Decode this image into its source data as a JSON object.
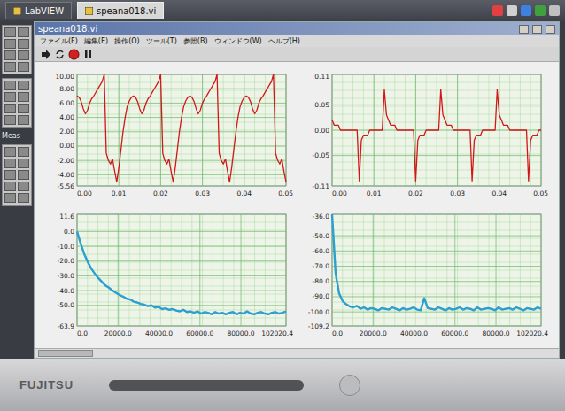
{
  "taskbar": {
    "tabs": [
      {
        "label": "LabVIEW",
        "selected": false
      },
      {
        "label": "speana018.vi",
        "selected": true
      }
    ]
  },
  "palette": {
    "label": "Meas"
  },
  "window": {
    "title": "speana018.vi",
    "menu": [
      "ファイル(F)",
      "編集(E)",
      "操作(O)",
      "ツール(T)",
      "参照(B)",
      "ウィンドウ(W)",
      "ヘルプ(H)"
    ]
  },
  "charts": [
    {
      "y_ticks": [
        "10.00",
        "8.00",
        "6.00",
        "4.00",
        "2.00",
        "0.00",
        "-2.00",
        "-4.00",
        "-5.56"
      ],
      "x_ticks": [
        "0.00",
        "0.01",
        "0.02",
        "0.03",
        "0.04",
        "0.05"
      ],
      "series": [
        {
          "color": "#d01818",
          "values": [
            7.0,
            6.8,
            6.2,
            5.2,
            4.5,
            5.0,
            6.0,
            6.6,
            7.0,
            7.5,
            8.0,
            8.5,
            9.0,
            10.0,
            -1.0,
            -2.0,
            -2.5,
            -1.8,
            -3.5,
            -5.0,
            -3.0,
            -0.5,
            2.0,
            4.0,
            5.5,
            6.3,
            6.8,
            7.0,
            6.8,
            6.2,
            5.2,
            4.5,
            5.0,
            6.0,
            6.6,
            7.0,
            7.5,
            8.0,
            8.5,
            9.0,
            10.0,
            -1.0,
            -2.0,
            -2.5,
            -1.8,
            -3.5,
            -5.0,
            -3.0,
            -0.5,
            2.0,
            4.0,
            5.5,
            6.3,
            6.8,
            7.0,
            6.8,
            6.2,
            5.2,
            4.5,
            5.0,
            6.0,
            6.6,
            7.0,
            7.5,
            8.0,
            8.5,
            9.0,
            10.0,
            -1.0,
            -2.0,
            -2.5,
            -1.8,
            -3.5,
            -5.0,
            -3.0,
            -0.5,
            2.0,
            4.0,
            5.5,
            6.3,
            6.8,
            7.0,
            6.8,
            6.2,
            5.2,
            4.5,
            5.0,
            6.0,
            6.6,
            7.0,
            7.5,
            8.0,
            8.5,
            9.0,
            10.0,
            -1.0,
            -2.0,
            -2.5,
            -1.8,
            -3.5,
            -5.0
          ]
        }
      ]
    },
    {
      "y_ticks": [
        "0.11",
        "0.05",
        "0.00",
        "-0.05",
        "-0.11"
      ],
      "x_ticks": [
        "0.00",
        "0.01",
        "0.02",
        "0.03",
        "0.04",
        "0.05"
      ],
      "series": [
        {
          "color": "#d01818",
          "values": [
            0.02,
            0.01,
            0.01,
            0.01,
            0.0,
            0.0,
            0.0,
            0.0,
            0.0,
            0.0,
            0.0,
            0.0,
            0.0,
            -0.1,
            -0.02,
            -0.01,
            -0.01,
            -0.01,
            0.0,
            0.0,
            0.0,
            0.0,
            0.0,
            0.0,
            0.0,
            0.08,
            0.03,
            0.02,
            0.01,
            0.01,
            0.01,
            0.0,
            0.0,
            0.0,
            0.0,
            0.0,
            0.0,
            0.0,
            0.0,
            0.0,
            -0.1,
            -0.02,
            -0.01,
            -0.01,
            -0.01,
            0.0,
            0.0,
            0.0,
            0.0,
            0.0,
            0.0,
            0.0,
            0.08,
            0.03,
            0.02,
            0.01,
            0.01,
            0.01,
            0.0,
            0.0,
            0.0,
            0.0,
            0.0,
            0.0,
            0.0,
            0.0,
            0.0,
            -0.1,
            -0.02,
            -0.01,
            -0.01,
            -0.01,
            0.0,
            0.0,
            0.0,
            0.0,
            0.0,
            0.0,
            0.0,
            0.08,
            0.03,
            0.02,
            0.01,
            0.01,
            0.01,
            0.0,
            0.0,
            0.0,
            0.0,
            0.0,
            0.0,
            0.0,
            0.0,
            0.0,
            -0.1,
            -0.02,
            -0.01,
            -0.01,
            -0.01,
            0.0,
            0.0
          ]
        }
      ]
    },
    {
      "y_ticks": [
        "11.6",
        "0.0",
        "-10.0",
        "-20.0",
        "-30.0",
        "-40.0",
        "-50.0",
        "-63.9"
      ],
      "x_ticks": [
        "0.0",
        "20000.0",
        "40000.0",
        "60000.0",
        "80000.0",
        "102020.4"
      ],
      "series": [
        {
          "color": "#2a9fd0",
          "values": [
            0.0,
            -8.0,
            -15.0,
            -20.5,
            -25.0,
            -28.5,
            -31.5,
            -34.0,
            -36.5,
            -38.0,
            -40.0,
            -41.5,
            -43.0,
            -44.0,
            -45.5,
            -46.0,
            -47.5,
            -48.0,
            -49.0,
            -49.5,
            -50.5,
            -50.0,
            -51.5,
            -51.0,
            -52.5,
            -52.0,
            -53.0,
            -52.5,
            -53.5,
            -54.0,
            -53.0,
            -54.5,
            -54.0,
            -55.0,
            -54.0,
            -55.5,
            -54.5,
            -55.0,
            -56.0,
            -54.5,
            -55.5,
            -55.0,
            -56.0,
            -55.0,
            -54.5,
            -56.0,
            -55.0,
            -55.5,
            -54.0,
            -55.5,
            -56.0,
            -55.0,
            -54.5,
            -55.5,
            -56.0,
            -55.0,
            -54.5,
            -55.5,
            -55.0,
            -54.0
          ]
        }
      ]
    },
    {
      "y_ticks": [
        "-36.0",
        "-50.0",
        "-60.0",
        "-70.0",
        "-80.0",
        "-90.0",
        "-100.0",
        "-109.2"
      ],
      "x_ticks": [
        "0.0",
        "20000.0",
        "40000.0",
        "60000.0",
        "80000.0",
        "102020.4"
      ],
      "series": [
        {
          "color": "#2a9fd0",
          "values": [
            -36.0,
            -75.0,
            -88.0,
            -93.0,
            -95.0,
            -96.5,
            -97.0,
            -96.0,
            -98.0,
            -97.0,
            -98.5,
            -97.5,
            -98.0,
            -99.0,
            -97.5,
            -98.0,
            -98.5,
            -97.0,
            -98.0,
            -99.0,
            -97.5,
            -98.5,
            -98.0,
            -97.0,
            -98.5,
            -99.0,
            -91.0,
            -97.5,
            -98.0,
            -98.5,
            -97.0,
            -98.0,
            -99.0,
            -97.5,
            -98.5,
            -98.0,
            -97.0,
            -98.5,
            -97.5,
            -98.0,
            -99.0,
            -97.0,
            -98.5,
            -98.0,
            -97.5,
            -98.0,
            -99.0,
            -97.0,
            -98.5,
            -98.0,
            -97.5,
            -98.5,
            -97.0,
            -98.0,
            -99.0,
            -97.5,
            -98.0,
            -98.5,
            -97.0,
            -98.0
          ]
        }
      ]
    }
  ],
  "bezel": {
    "brand": "FUJITSU"
  }
}
